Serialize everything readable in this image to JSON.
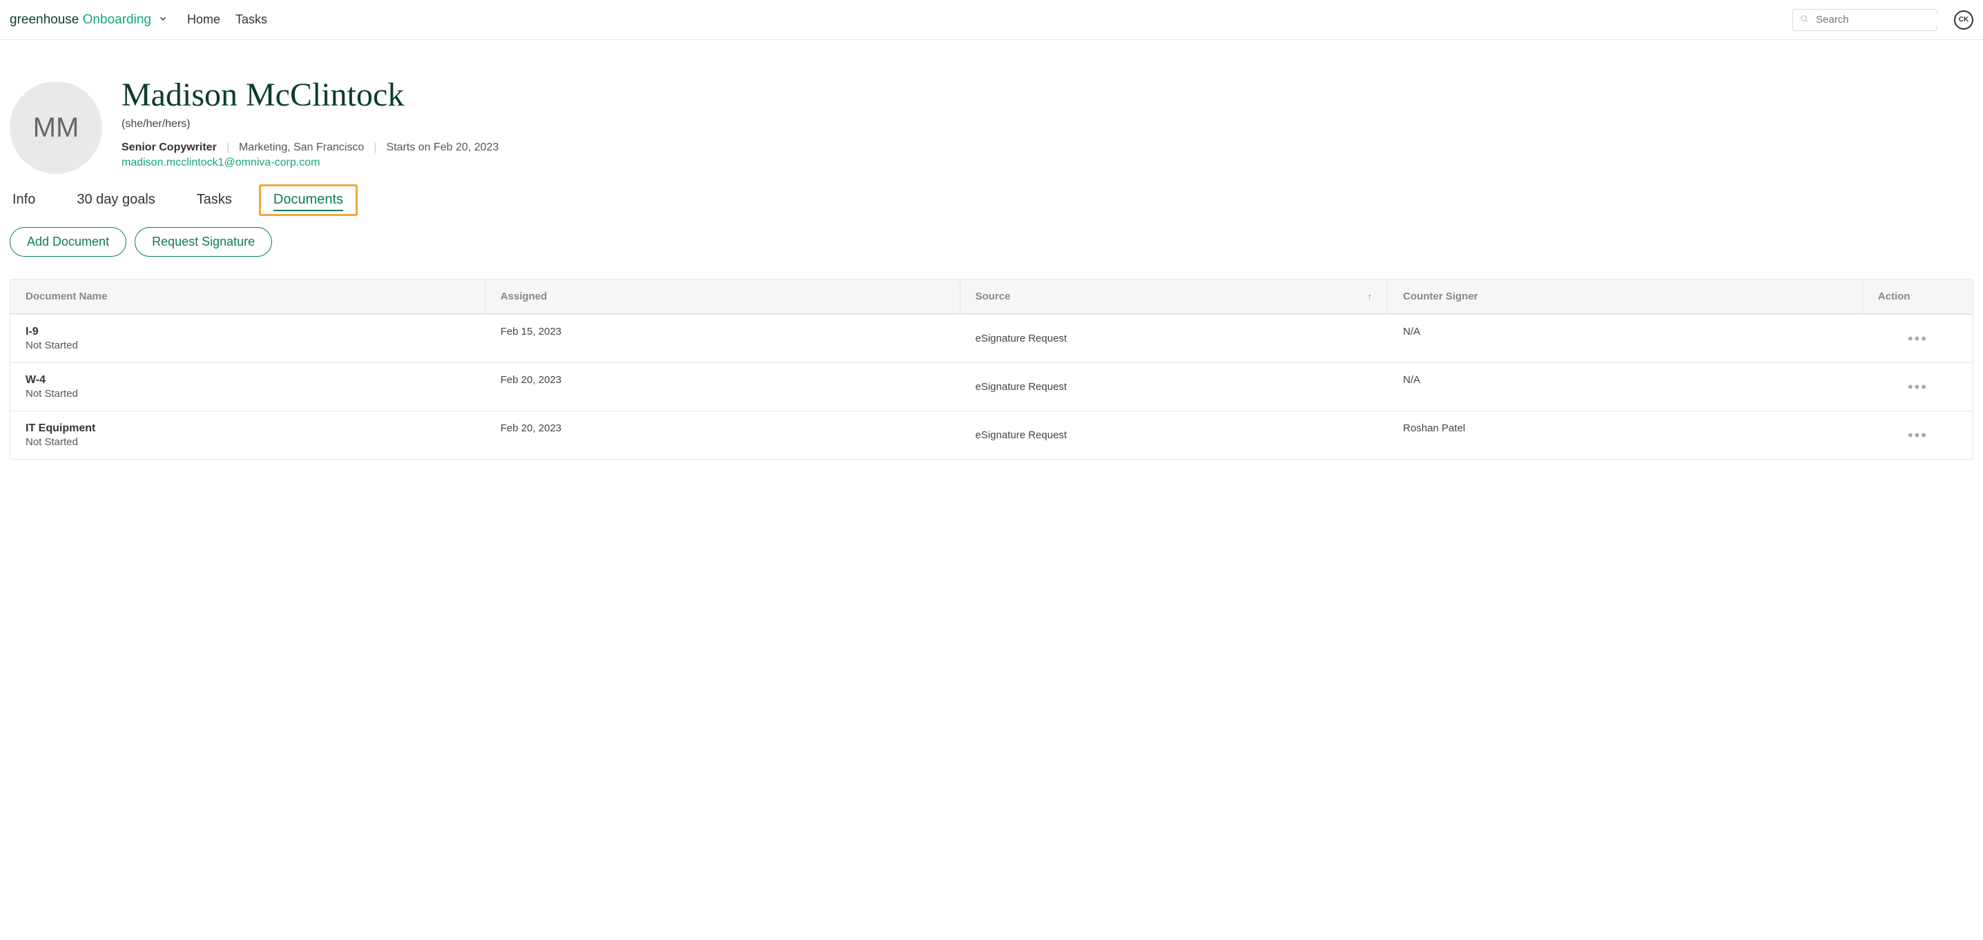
{
  "header": {
    "logo_part1": "greenhouse",
    "logo_part2": "Onboarding",
    "nav": {
      "home": "Home",
      "tasks": "Tasks"
    },
    "search_placeholder": "Search",
    "user_initials": "CK"
  },
  "profile": {
    "avatar_initials": "MM",
    "name": "Madison McClintock",
    "pronouns": "(she/her/hers)",
    "job_title": "Senior Copywriter",
    "dept_location": "Marketing, San Francisco",
    "start_text": "Starts on Feb 20, 2023",
    "email": "madison.mcclintock1@omniva-corp.com"
  },
  "tabs": {
    "info": "Info",
    "goals": "30 day goals",
    "tasks": "Tasks",
    "documents": "Documents"
  },
  "actions": {
    "add_document": "Add Document",
    "request_signature": "Request Signature"
  },
  "table": {
    "headers": {
      "name": "Document Name",
      "assigned": "Assigned",
      "source": "Source",
      "signer": "Counter Signer",
      "action": "Action",
      "sort_arrow": "↑"
    },
    "rows": [
      {
        "name": "I-9",
        "status": "Not Started",
        "assigned": "Feb 15, 2023",
        "source": "eSignature Request",
        "signer": "N/A"
      },
      {
        "name": "W-4",
        "status": "Not Started",
        "assigned": "Feb 20, 2023",
        "source": "eSignature Request",
        "signer": "N/A"
      },
      {
        "name": "IT Equipment",
        "status": "Not Started",
        "assigned": "Feb 20, 2023",
        "source": "eSignature Request",
        "signer": "Roshan Patel"
      }
    ]
  }
}
